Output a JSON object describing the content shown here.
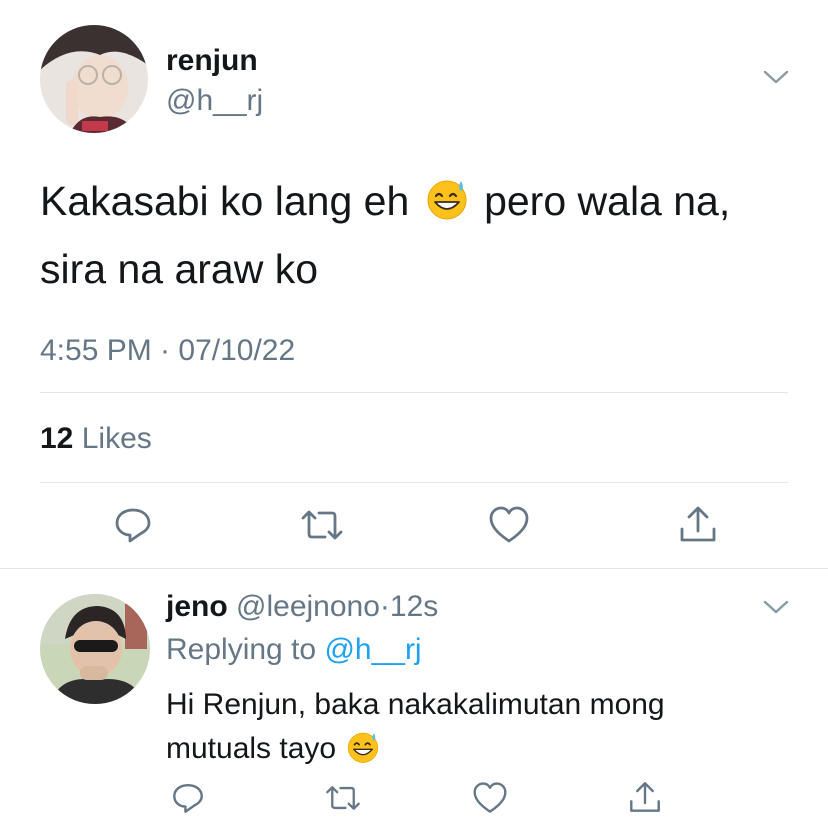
{
  "tweet": {
    "display_name": "renjun",
    "handle": "@h__rj",
    "text_part1": "Kakasabi ko lang eh",
    "text_part2": "pero wala na,",
    "text_line2": "sira na araw ko",
    "emoji": "sweat-smile-emoji",
    "timestamp": "4:55 PM · 07/10/22",
    "likes_count": "12",
    "likes_label": "Likes"
  },
  "reply": {
    "display_name": "jeno",
    "handle": "@leejnono",
    "separator": "·",
    "time": "12s",
    "replying_to_label": "Replying to",
    "replying_to_handle": "@h__rj",
    "text_line1": "Hi Renjun, baka nakakalimutan mong",
    "text_line2": "mutuals tayo",
    "emoji": "sweat-smile-emoji"
  },
  "icons": [
    "chevron-down-icon",
    "reply-icon",
    "retweet-icon",
    "like-icon",
    "share-icon"
  ],
  "colors": {
    "text": "#14171a",
    "muted": "#657786",
    "link": "#1da1f2",
    "divider": "#e1e8ed",
    "icon": "#657786"
  }
}
